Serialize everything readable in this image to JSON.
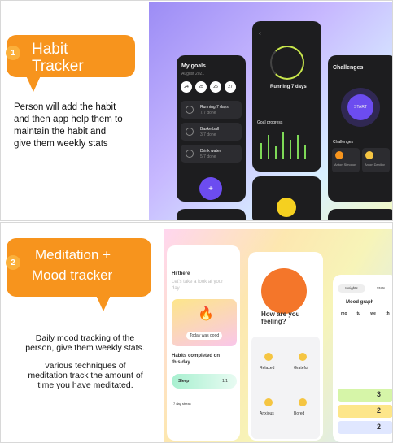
{
  "slide1": {
    "number": "1",
    "title_line1": "Habit",
    "title_line2": "Tracker",
    "description": "Person will add the habit and then app help them to maintain the habit and give them weekly stats",
    "mock": {
      "goals_title": "My goals",
      "goals_date": "August 2021",
      "dates": [
        "24",
        "25",
        "26",
        "27"
      ],
      "habits": [
        {
          "name": "Running 7 days",
          "sub": "7/7 done"
        },
        {
          "name": "Basketball",
          "sub": "3/7 done"
        },
        {
          "name": "Drink water",
          "sub": "5/7 done"
        }
      ],
      "running_title": "Running 7 days",
      "goal_progress": "Goal progress",
      "challenges_title": "Challenges",
      "start_label": "START",
      "challenges_sub": "Challenges",
      "friends": [
        "Anton Simonov",
        "Anton Danilov"
      ]
    }
  },
  "slide2": {
    "number": "2",
    "title_line1": "Meditation +",
    "title_line2": "Mood tracker",
    "desc1": "Daily mood tracking of the person, give them weekly stats.",
    "desc2": "various techniques of meditation track the amount of time you have meditated.",
    "mock": {
      "greeting": "Hi there",
      "prompt": "Let's take a look at your day",
      "today_good": "Today was good",
      "habits_completed": "Habits completed on this day",
      "sleep": "Sleep",
      "sleep_count": "1/1",
      "streak": "7 day streak",
      "how_feeling": "How are you feeling?",
      "moods": [
        "Relaxed",
        "Grateful",
        "Anxious",
        "Bored"
      ],
      "tabs": [
        "Insights",
        "Stats"
      ],
      "mood_graph": "Mood graph",
      "days": [
        "mo",
        "tu",
        "we",
        "th"
      ],
      "stat_values": [
        "3",
        "2",
        "2"
      ]
    }
  },
  "colors": {
    "accent": "#f7941d",
    "badge": "#fbb03b",
    "purple": "#6c4cf0"
  }
}
